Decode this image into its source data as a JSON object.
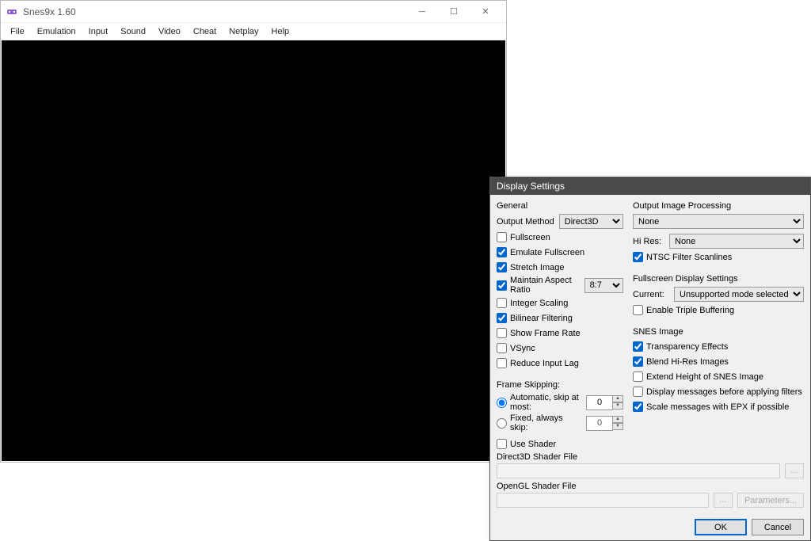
{
  "main": {
    "title": "Snes9x 1.60",
    "menu": [
      "File",
      "Emulation",
      "Input",
      "Sound",
      "Video",
      "Cheat",
      "Netplay",
      "Help"
    ]
  },
  "dialog": {
    "title": "Display Settings",
    "general": {
      "label": "General",
      "output_method_label": "Output Method",
      "output_method_value": "Direct3D",
      "fullscreen": "Fullscreen",
      "emulate_fullscreen": "Emulate Fullscreen",
      "stretch_image": "Stretch Image",
      "maintain_aspect": "Maintain Aspect Ratio",
      "aspect_value": "8:7",
      "integer_scaling": "Integer Scaling",
      "bilinear": "Bilinear Filtering",
      "show_framerate": "Show Frame Rate",
      "vsync": "VSync",
      "reduce_input_lag": "Reduce Input Lag"
    },
    "frame_skipping": {
      "label": "Frame Skipping:",
      "auto_label": "Automatic, skip at most:",
      "auto_value": "0",
      "fixed_label": "Fixed, always skip:",
      "fixed_value": "0"
    },
    "output_proc": {
      "label": "Output Image Processing",
      "value": "None",
      "hires_label": "Hi Res:",
      "hires_value": "None",
      "ntsc_scanlines": "NTSC Filter Scanlines"
    },
    "fs_display": {
      "label": "Fullscreen Display Settings",
      "current_label": "Current:",
      "current_value": "Unsupported mode selected",
      "triple_buffer": "Enable Triple Buffering"
    },
    "snes_image": {
      "label": "SNES Image",
      "transparency": "Transparency Effects",
      "blend_hires": "Blend Hi-Res Images",
      "extend_height": "Extend Height of SNES Image",
      "display_before_filters": "Display messages before applying filters",
      "scale_epx": "Scale messages with EPX if possible"
    },
    "shader": {
      "use_shader": "Use Shader",
      "d3d_label": "Direct3D Shader File",
      "ogl_label": "OpenGL Shader File",
      "params": "Parameters..."
    },
    "buttons": {
      "ok": "OK",
      "cancel": "Cancel"
    }
  }
}
